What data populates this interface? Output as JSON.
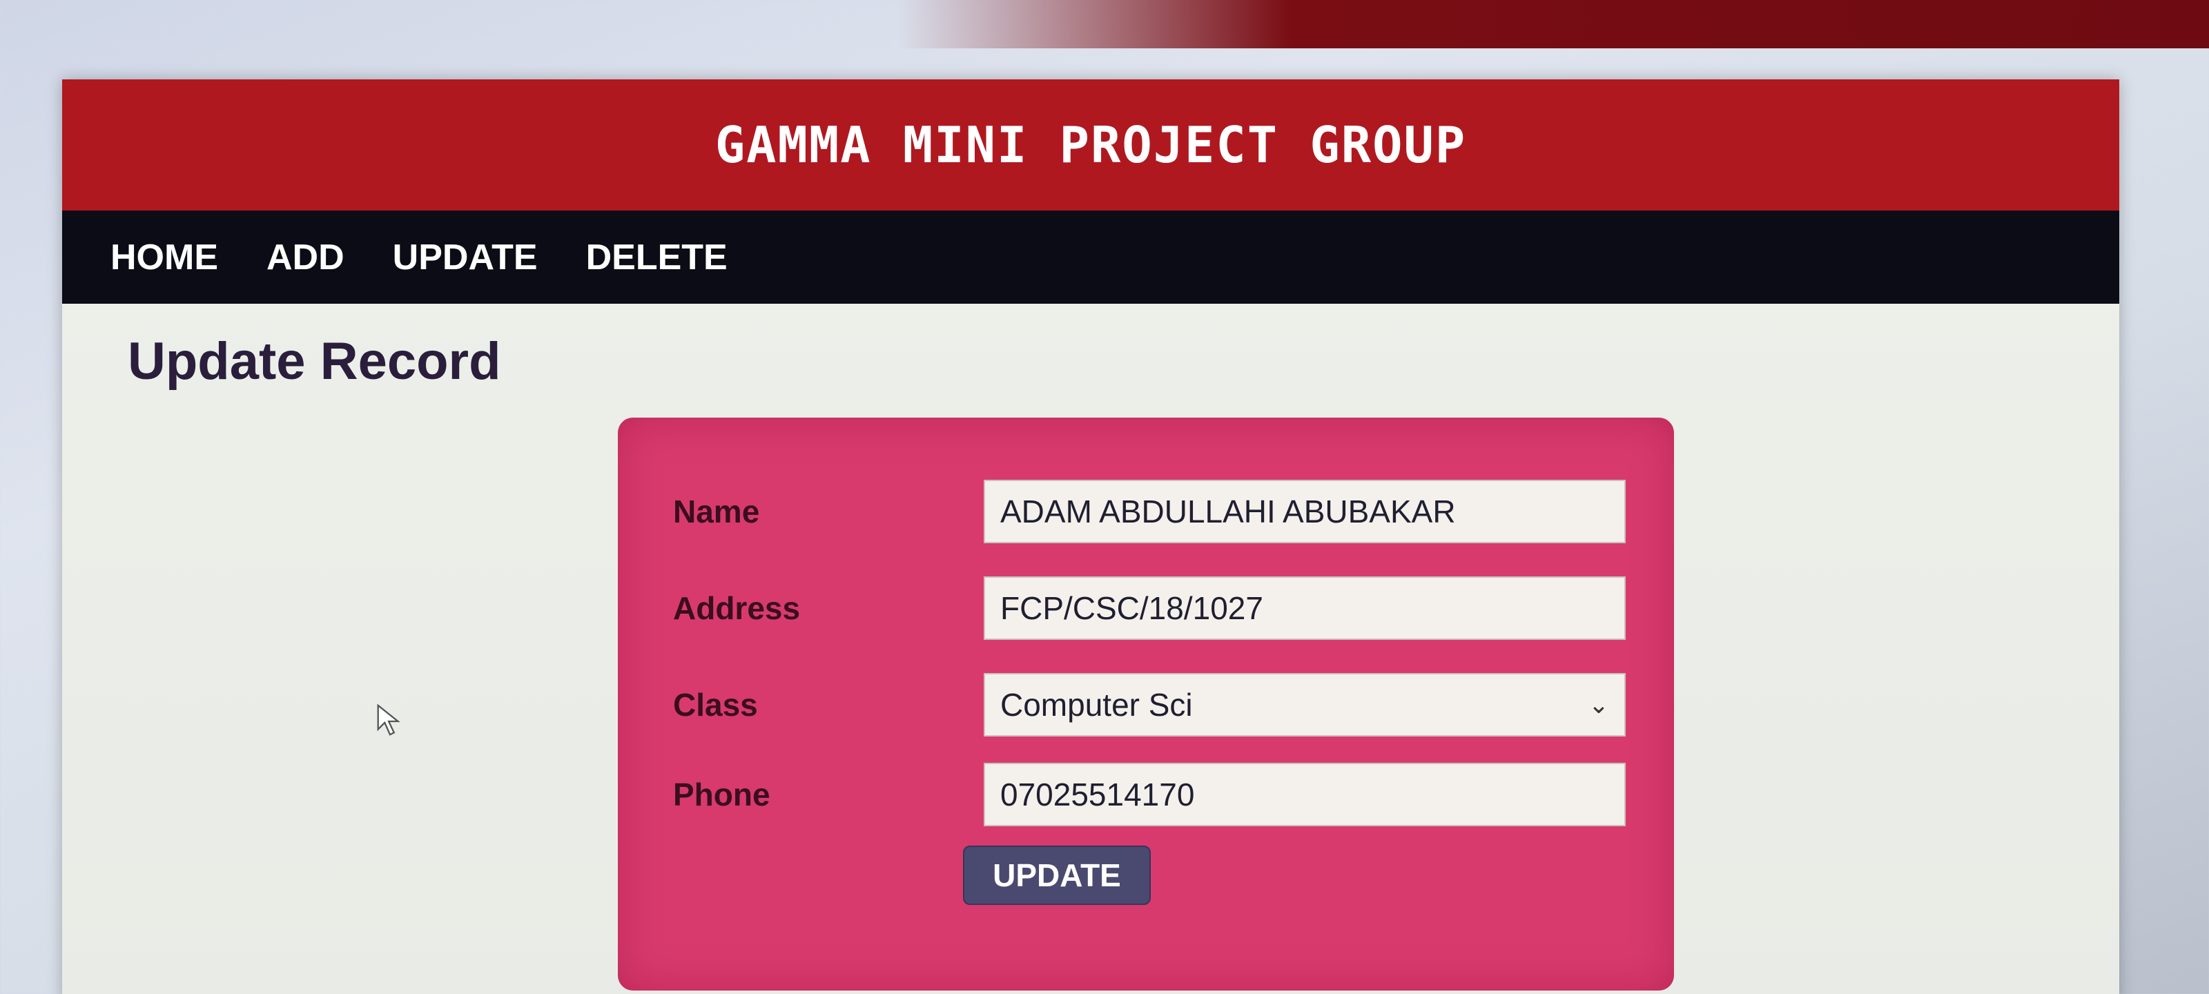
{
  "site": {
    "title": "GAMMA MINI PROJECT GROUP"
  },
  "nav": {
    "items": [
      "HOME",
      "ADD",
      "UPDATE",
      "DELETE"
    ]
  },
  "page": {
    "title": "Update Record"
  },
  "form": {
    "fields": [
      {
        "label": "Name",
        "value": "ADAM ABDULLAHI ABUBAKAR"
      },
      {
        "label": "Address",
        "value": "FCP/CSC/18/1027"
      },
      {
        "label": "Class",
        "value": "Computer Sci"
      },
      {
        "label": "Phone",
        "value": "07025514170"
      }
    ],
    "submit_label": "UPDATE"
  },
  "colors": {
    "header": "#b01820",
    "nav": "#0c0c16",
    "card": "#d83a6e",
    "button": "#4a4a70"
  },
  "icons": {
    "cursor": "mouse-pointer-icon",
    "select": "chevron-down-icon"
  }
}
